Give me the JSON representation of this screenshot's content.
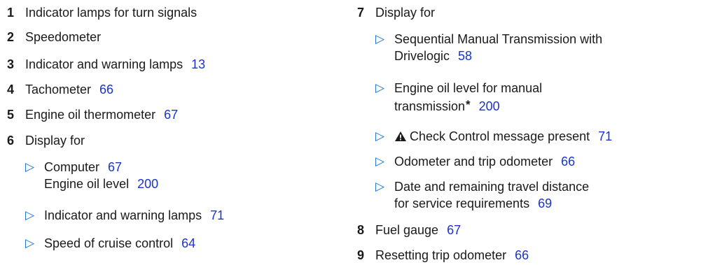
{
  "left": {
    "items": [
      {
        "num": "1",
        "label": "Indicator lamps for turn signals"
      },
      {
        "num": "2",
        "label": "Speedometer"
      },
      {
        "num": "3",
        "label": "Indicator and warning lamps",
        "page": "13"
      },
      {
        "num": "4",
        "label": "Tachometer",
        "page": "66"
      },
      {
        "num": "5",
        "label": "Engine oil thermometer",
        "page": "67"
      },
      {
        "num": "6",
        "label": "Display for"
      }
    ],
    "subitems": [
      {
        "line1": "Computer",
        "page1": "67",
        "line2": "Engine oil level",
        "page2": "200"
      },
      {
        "label": "Indicator and warning lamps",
        "page": "71"
      },
      {
        "label": "Speed of cruise control",
        "page": "64"
      }
    ]
  },
  "right": {
    "item7": {
      "num": "7",
      "label": "Display for"
    },
    "subitems": [
      {
        "line1": "Sequential Manual Transmission with",
        "line2": "Drivelogic",
        "page": "58"
      },
      {
        "line1": "Engine oil level for manual",
        "line2": "transmission",
        "asterisk": "*",
        "page": "200"
      },
      {
        "icon": "warning-triangle-icon",
        "label": "Check Control message present",
        "page": "71"
      },
      {
        "label": "Odometer and trip odometer",
        "page": "66"
      },
      {
        "line1": "Date and remaining travel distance",
        "line2": "for service requirements",
        "page": "69"
      }
    ],
    "items": [
      {
        "num": "8",
        "label": "Fuel gauge",
        "page": "67"
      },
      {
        "num": "9",
        "label": "Resetting trip odometer",
        "page": "66"
      }
    ]
  },
  "bullet_glyph": "▷",
  "colors": {
    "text": "#1a1a1a",
    "page_ref": "#1a33cc",
    "bullet": "#1a6fd6"
  }
}
